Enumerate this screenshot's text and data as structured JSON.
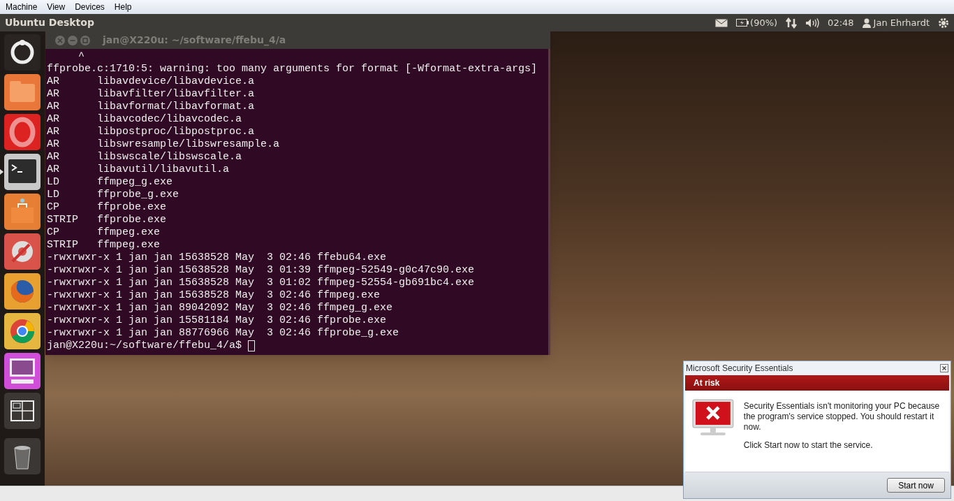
{
  "host_menu": [
    "Machine",
    "View",
    "Devices",
    "Help"
  ],
  "top_panel": {
    "title": "Ubuntu Desktop",
    "battery": "(90%)",
    "clock": "02:48",
    "user": "Jan Ehrhardt"
  },
  "launcher": [
    {
      "kind": "dash",
      "selected": false
    },
    {
      "kind": "files",
      "selected": false
    },
    {
      "kind": "opera",
      "selected": false
    },
    {
      "kind": "terminal",
      "selected": true
    },
    {
      "kind": "store",
      "selected": false
    },
    {
      "kind": "settings",
      "selected": false
    },
    {
      "kind": "firefox",
      "selected": false
    },
    {
      "kind": "chrome",
      "selected": false
    },
    {
      "kind": "monitor",
      "selected": false
    },
    {
      "kind": "workspaces",
      "selected": false
    },
    {
      "kind": "trash",
      "selected": false
    }
  ],
  "terminal": {
    "title": "jan@X220u: ~/software/ffebu_4/a",
    "lines": [
      "     ^",
      "ffprobe.c:1710:5: warning: too many arguments for format [-Wformat-extra-args]",
      "AR      libavdevice/libavdevice.a",
      "AR      libavfilter/libavfilter.a",
      "AR      libavformat/libavformat.a",
      "AR      libavcodec/libavcodec.a",
      "AR      libpostproc/libpostproc.a",
      "AR      libswresample/libswresample.a",
      "AR      libswscale/libswscale.a",
      "AR      libavutil/libavutil.a",
      "LD      ffmpeg_g.exe",
      "LD      ffprobe_g.exe",
      "CP      ffprobe.exe",
      "STRIP   ffprobe.exe",
      "CP      ffmpeg.exe",
      "STRIP   ffmpeg.exe",
      "-rwxrwxr-x 1 jan jan 15638528 May  3 02:46 ffebu64.exe",
      "-rwxrwxr-x 1 jan jan 15638528 May  3 01:39 ffmpeg-52549-g0c47c90.exe",
      "-rwxrwxr-x 1 jan jan 15638528 May  3 01:02 ffmpeg-52554-gb691bc4.exe",
      "-rwxrwxr-x 1 jan jan 15638528 May  3 02:46 ffmpeg.exe",
      "-rwxrwxr-x 1 jan jan 89042092 May  3 02:46 ffmpeg_g.exe",
      "-rwxrwxr-x 1 jan jan 15581184 May  3 02:46 ffprobe.exe",
      "-rwxrwxr-x 1 jan jan 88776966 May  3 02:46 ffprobe_g.exe"
    ],
    "prompt": "jan@X220u:~/software/ffebu_4/a$"
  },
  "notification": {
    "title": "Microsoft Security Essentials",
    "status": "At risk",
    "message": "Security Essentials isn't monitoring your PC because the program's service stopped. You should restart it now.",
    "hint": "Click Start now to start the service.",
    "button": "Start now"
  }
}
